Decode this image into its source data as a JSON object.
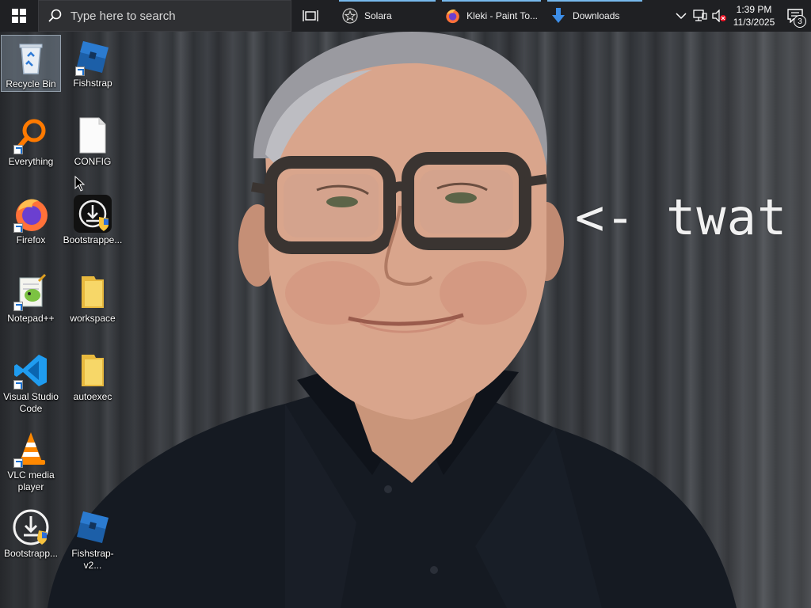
{
  "taskbar": {
    "search_placeholder": "Type here to search",
    "tasks": [
      {
        "label": "Solara",
        "icon": "solara-icon"
      },
      {
        "label": "Kleki - Paint To...",
        "icon": "firefox-icon"
      },
      {
        "label": "Downloads",
        "icon": "download-arrow-icon"
      }
    ],
    "clock": {
      "time": "1:39 PM",
      "date": "11/3/2025"
    },
    "notification_count": "3",
    "accent_color": "#76b9ed"
  },
  "desktop": {
    "icons": [
      {
        "label": "Recycle Bin",
        "icon": "recycle-bin-icon",
        "selected": true
      },
      {
        "label": "Fishstrap",
        "icon": "fishstrap-icon"
      },
      {
        "label": "Everything",
        "icon": "everything-search-icon"
      },
      {
        "label": "CONFIG",
        "icon": "text-file-icon"
      },
      {
        "label": "Firefox",
        "icon": "firefox-icon"
      },
      {
        "label": "Bootstrappe...",
        "icon": "bootstrapper-icon"
      },
      {
        "label": "Notepad++",
        "icon": "notepad-plus-plus-icon"
      },
      {
        "label": "workspace",
        "icon": "folder-icon"
      },
      {
        "label": "Visual Studio Code",
        "icon": "vscode-icon"
      },
      {
        "label": "autoexec",
        "icon": "folder-icon"
      },
      {
        "label": "VLC media player",
        "icon": "vlc-icon"
      },
      {
        "label": "Bootstrapp...",
        "icon": "bootstrapper-icon"
      },
      {
        "label": "Fishstrap-v2...",
        "icon": "fishstrap-icon"
      }
    ]
  },
  "wallpaper": {
    "caption": "<- twat"
  }
}
